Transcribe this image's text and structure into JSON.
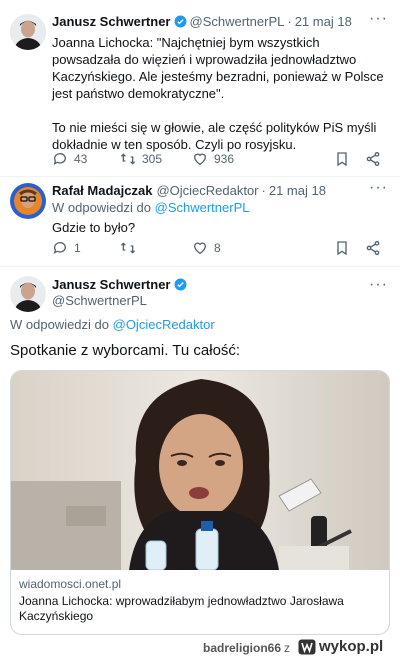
{
  "tweets": [
    {
      "author_name": "Janusz Schwertner",
      "handle": "@SchwertnerPL",
      "separator": "·",
      "date": "21 maj 18",
      "text": "Joanna Lichocka: \"Najchętniej bym wszystkich powsadzała do więzień i wprowadziła jednowładztwo Kaczyńskiego. Ale jesteśmy bezradni, ponieważ w Polsce jest państwo demokratyczne\".\n\nTo nie mieści się w głowie, ale część polityków PiS myśli dokładnie w ten sposób. Czyli po rosyjsku.",
      "replies": "43",
      "retweets": "305",
      "likes": "936"
    },
    {
      "author_name": "Rafał Madajczak",
      "handle": "@OjciecRedaktor",
      "separator": "·",
      "date": "21 maj 18",
      "reply_prefix": "W odpowiedzi do",
      "reply_to": "@SchwertnerPL",
      "text": "Gdzie to było?",
      "replies": "1",
      "retweets": "",
      "likes": "8"
    }
  ],
  "main_tweet": {
    "author_name": "Janusz Schwertner",
    "handle": "@SchwertnerPL",
    "reply_prefix": "W odpowiedzi do",
    "reply_to": "@OjciecRedaktor",
    "text": "Spotkanie z wyborcami. Tu całość:",
    "card": {
      "domain": "wiadomosci.onet.pl",
      "title": "Joanna Lichocka: wprowadziłabym jednowładztwo Jarosława Kaczyńskiego"
    }
  },
  "more_icon": "more-dots-icon",
  "colors": {
    "accent": "#1d9bf0",
    "secondary_text": "#536471",
    "primary_text": "#0f1419",
    "border": "#cfd9de"
  },
  "footer": {
    "username": "badreligion66",
    "connector": "z",
    "brand": "wykop.pl"
  }
}
